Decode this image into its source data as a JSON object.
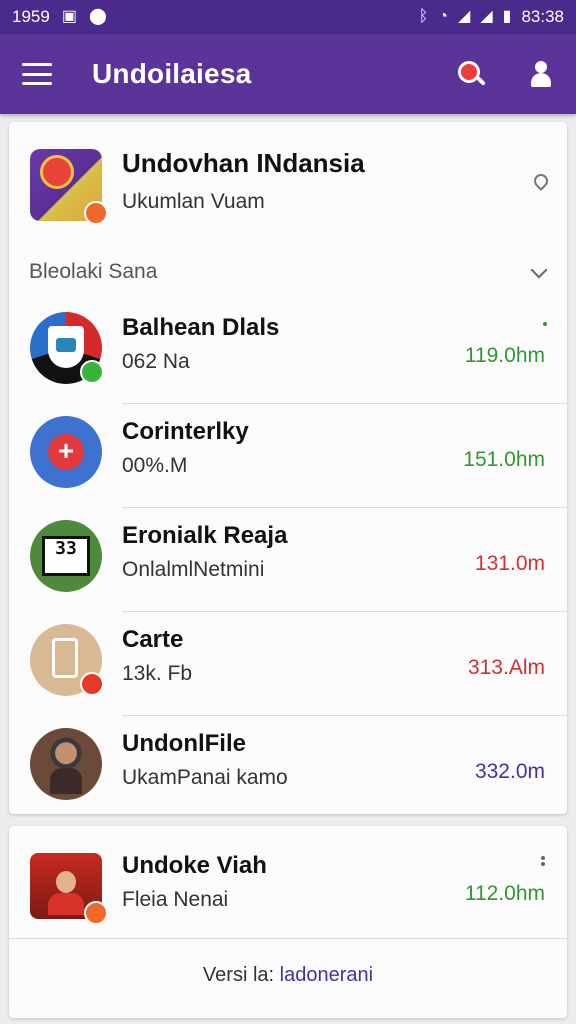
{
  "status_bar": {
    "time_left": "1959",
    "time_right": "83:38",
    "icons_left": [
      "image-icon",
      "location-icon"
    ],
    "icons_right": [
      "bluetooth-icon",
      "wifi-icon",
      "signal-icon",
      "signal-icon",
      "battery-icon"
    ]
  },
  "app_bar": {
    "title": "Undoilaiesa",
    "icons": [
      "menu-icon",
      "search-icon",
      "user-icon"
    ]
  },
  "header": {
    "title": "Undovhan INdansia",
    "subtitle": "Ukumlan Vuam"
  },
  "section": {
    "label": "Bleolaki Sana"
  },
  "rows": [
    {
      "title": "Balhean Dlals",
      "subtitle": "062 Na",
      "value": "119.0hm",
      "value_color": "#2e9a2e"
    },
    {
      "title": "Corinterlky",
      "subtitle": "00%.M",
      "value": "151.0hm",
      "value_color": "#2e9a2e"
    },
    {
      "title": "Eronialk Reaja",
      "subtitle": "OnlalmlNetmini",
      "value": "131.0m",
      "value_color": "#d32f2f",
      "avatar_text": "33"
    },
    {
      "title": "Carte",
      "subtitle": "13k. Fb",
      "value": "313.Alm",
      "value_color": "#d32f2f"
    },
    {
      "title": "UndonlFile",
      "subtitle": "UkamPanai kamo",
      "value": "332.0m",
      "value_color": "#4a2fa0"
    }
  ],
  "card2": {
    "title": "Undoke Viah",
    "subtitle": "Fleia Nenai",
    "value": "112.0hm",
    "value_color": "#2e9a2e",
    "version_prefix": "Versi la:",
    "version_link": "ladonerani"
  },
  "colors": {
    "primary": "#5b3499",
    "status_bar": "#4a2a8a",
    "accent_red": "#ef3b3b"
  }
}
